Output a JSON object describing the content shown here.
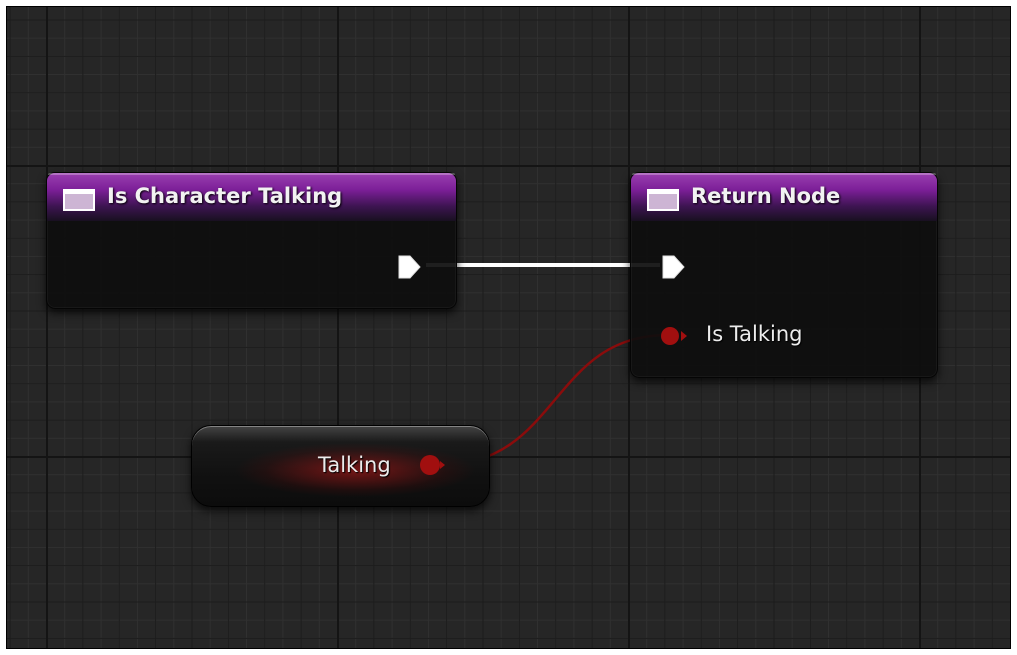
{
  "nodes": {
    "function_entry": {
      "title": "Is Character Talking",
      "icon": "function-icon"
    },
    "return_node": {
      "title": "Return Node",
      "icon": "function-icon",
      "output_pin_label": "Is Talking"
    },
    "variable_get": {
      "label": "Talking"
    }
  },
  "colors": {
    "header_purple": "#7c1f98",
    "bool_pin": "#a10f0f",
    "exec_wire": "#ffffff",
    "graph_background": "#262626"
  }
}
